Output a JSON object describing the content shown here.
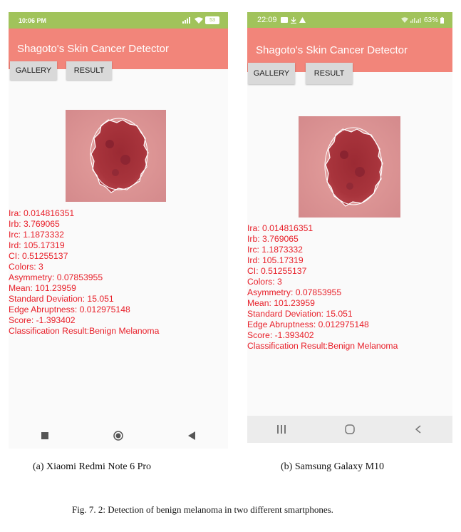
{
  "phones": [
    {
      "status": {
        "time": "10:06 PM",
        "icons": [
          "signal-icon",
          "wifi-icon",
          "battery-icon"
        ],
        "battery": "53"
      },
      "title": "Shagoto's Skin Cancer  Detector",
      "buttons": {
        "gallery": "GALLERY",
        "result": "RESULT"
      },
      "results": [
        "Ira: 0.014816351",
        "Irb: 3.769065",
        "Irc: 1.1873332",
        "Ird: 105.17319",
        "CI: 0.51255137",
        "Colors: 3",
        "Asymmetry: 0.07853955",
        "Mean: 101.23959",
        "Standard Deviation: 15.051",
        "Edge Abruptness: 0.012975148",
        "Score: -1.393402",
        "Classification Result:Benign Melanoma"
      ],
      "nav": [
        "recents-square-icon",
        "home-circle-icon",
        "back-triangle-icon"
      ]
    },
    {
      "status": {
        "time": "22:09",
        "icons": [
          "message-icon",
          "download-icon",
          "warning-icon",
          "wifi-icon",
          "signal-icon",
          "battery-icon"
        ],
        "battery": "63%"
      },
      "title": "Shagoto's Skin Cancer  Detector",
      "buttons": {
        "gallery": "GALLERY",
        "result": "RESULT"
      },
      "results": [
        "Ira: 0.014816351",
        "Irb: 3.769065",
        "Irc: 1.1873332",
        "Ird: 105.17319",
        "CI: 0.51255137",
        "Colors: 3",
        "Asymmetry: 0.07853955",
        "Mean: 101.23959",
        "Standard Deviation: 15.051",
        "Edge Abruptness: 0.012975148",
        "Score: -1.393402",
        "Classification Result:Benign Melanoma"
      ],
      "nav": [
        "recents-lines-icon",
        "home-rounded-icon",
        "back-chevron-icon"
      ]
    }
  ],
  "colors": {
    "status_bar": "#a1c35b",
    "app_bar": "#f2857a",
    "result_text": "#e8202a",
    "button": "#d9d9d9"
  },
  "captions": {
    "sub_a": "(a) Xiaomi Redmi Note 6 Pro",
    "sub_b": "(b) Samsung Galaxy M10",
    "figure": "Fig. 7. 2: Detection of benign melanoma in two different smartphones."
  }
}
